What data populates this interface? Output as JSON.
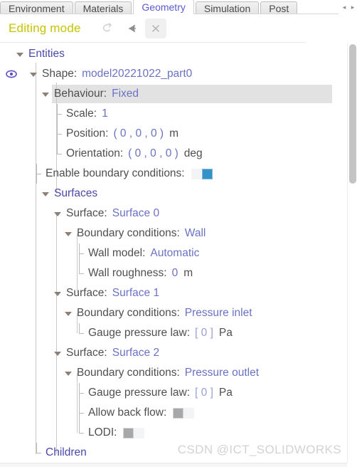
{
  "tabs": {
    "items": [
      {
        "label": "Environment",
        "active": false
      },
      {
        "label": "Materials",
        "active": false
      },
      {
        "label": "Geometry",
        "active": true
      },
      {
        "label": "Simulation",
        "active": false
      },
      {
        "label": "Post",
        "active": false
      }
    ],
    "nav_prev": "◂",
    "nav_next": "▸"
  },
  "header": {
    "mode_label": "Editing mode",
    "undo_icon": "undo-icon",
    "redo_icon": "redo-icon",
    "close_icon": "close-icon",
    "close_glyph": "×"
  },
  "tree": {
    "entities": {
      "label": "Entities"
    },
    "shape": {
      "label": "Shape:",
      "value": "model20221022_part0",
      "visibility_icon": "eye-icon"
    },
    "behaviour": {
      "label": "Behaviour:",
      "value": "Fixed",
      "selected": true
    },
    "scale": {
      "label": "Scale:",
      "value": "1",
      "unit": ""
    },
    "position": {
      "label": "Position:",
      "value": "( 0 , 0 , 0 )",
      "unit": "m"
    },
    "orientation": {
      "label": "Orientation:",
      "value": "( 0 , 0 , 0 )",
      "unit": "deg"
    },
    "enable_bc": {
      "label": "Enable boundary conditions:",
      "state": "on"
    },
    "surfaces_group": {
      "label": "Surfaces"
    },
    "surface0": {
      "label": "Surface:",
      "value": "Surface 0",
      "bc_label": "Boundary conditions:",
      "bc_value": "Wall",
      "wall_model": {
        "label": "Wall model:",
        "value": "Automatic"
      },
      "wall_roughness": {
        "label": "Wall roughness:",
        "value": "0",
        "unit": "m"
      }
    },
    "surface1": {
      "label": "Surface:",
      "value": "Surface 1",
      "bc_label": "Boundary conditions:",
      "bc_value": "Pressure inlet",
      "gauge": {
        "label": "Gauge pressure law:",
        "value": "[ 0 ]",
        "unit": "Pa"
      }
    },
    "surface2": {
      "label": "Surface:",
      "value": "Surface 2",
      "bc_label": "Boundary conditions:",
      "bc_value": "Pressure outlet",
      "gauge": {
        "label": "Gauge pressure law:",
        "value": "[ 0 ]",
        "unit": "Pa"
      },
      "allow_back_flow": {
        "label": "Allow back flow:",
        "state": "off"
      },
      "lodi": {
        "label": "LODI:",
        "state": "off"
      }
    },
    "children": {
      "label": "Children"
    }
  },
  "watermark": {
    "text": "CSDN @ICT_SOLIDWORKS"
  },
  "colors": {
    "accent_node": "#4a49a8",
    "value_blue": "#6b72c4",
    "editing_yellow": "#c6c400",
    "toggle_on": "#3392c8",
    "selection_gray": "#e2e2e2"
  }
}
